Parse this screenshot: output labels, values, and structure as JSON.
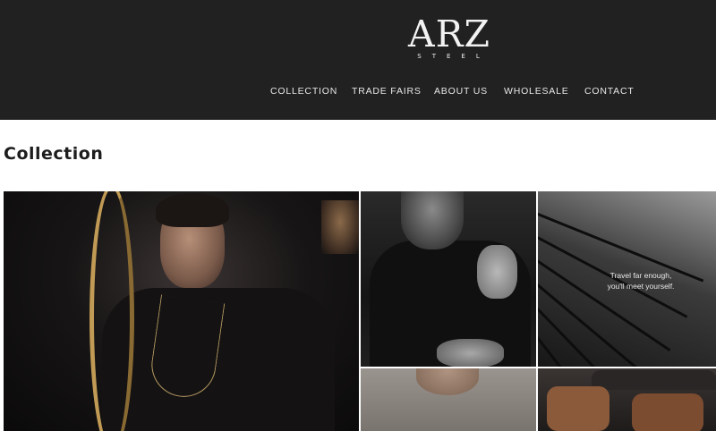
{
  "brand": {
    "logo_mark": "ARZ",
    "logo_sub": "STEEL"
  },
  "nav": {
    "items": [
      {
        "label": "COLLECTION"
      },
      {
        "label": "TRADE FAIRS"
      },
      {
        "label": "ABOUT US"
      },
      {
        "label": "WHOLESALE"
      },
      {
        "label": "CONTACT"
      }
    ]
  },
  "page": {
    "title": "Collection"
  },
  "gallery": {
    "quote_line1": "Travel far enough,",
    "quote_line2": "you'll meet yourself."
  },
  "colors": {
    "header_bg": "#222121",
    "page_bg": "#ffffff",
    "nav_text": "#e8e8e8",
    "gold_accent": "#c19b55"
  }
}
